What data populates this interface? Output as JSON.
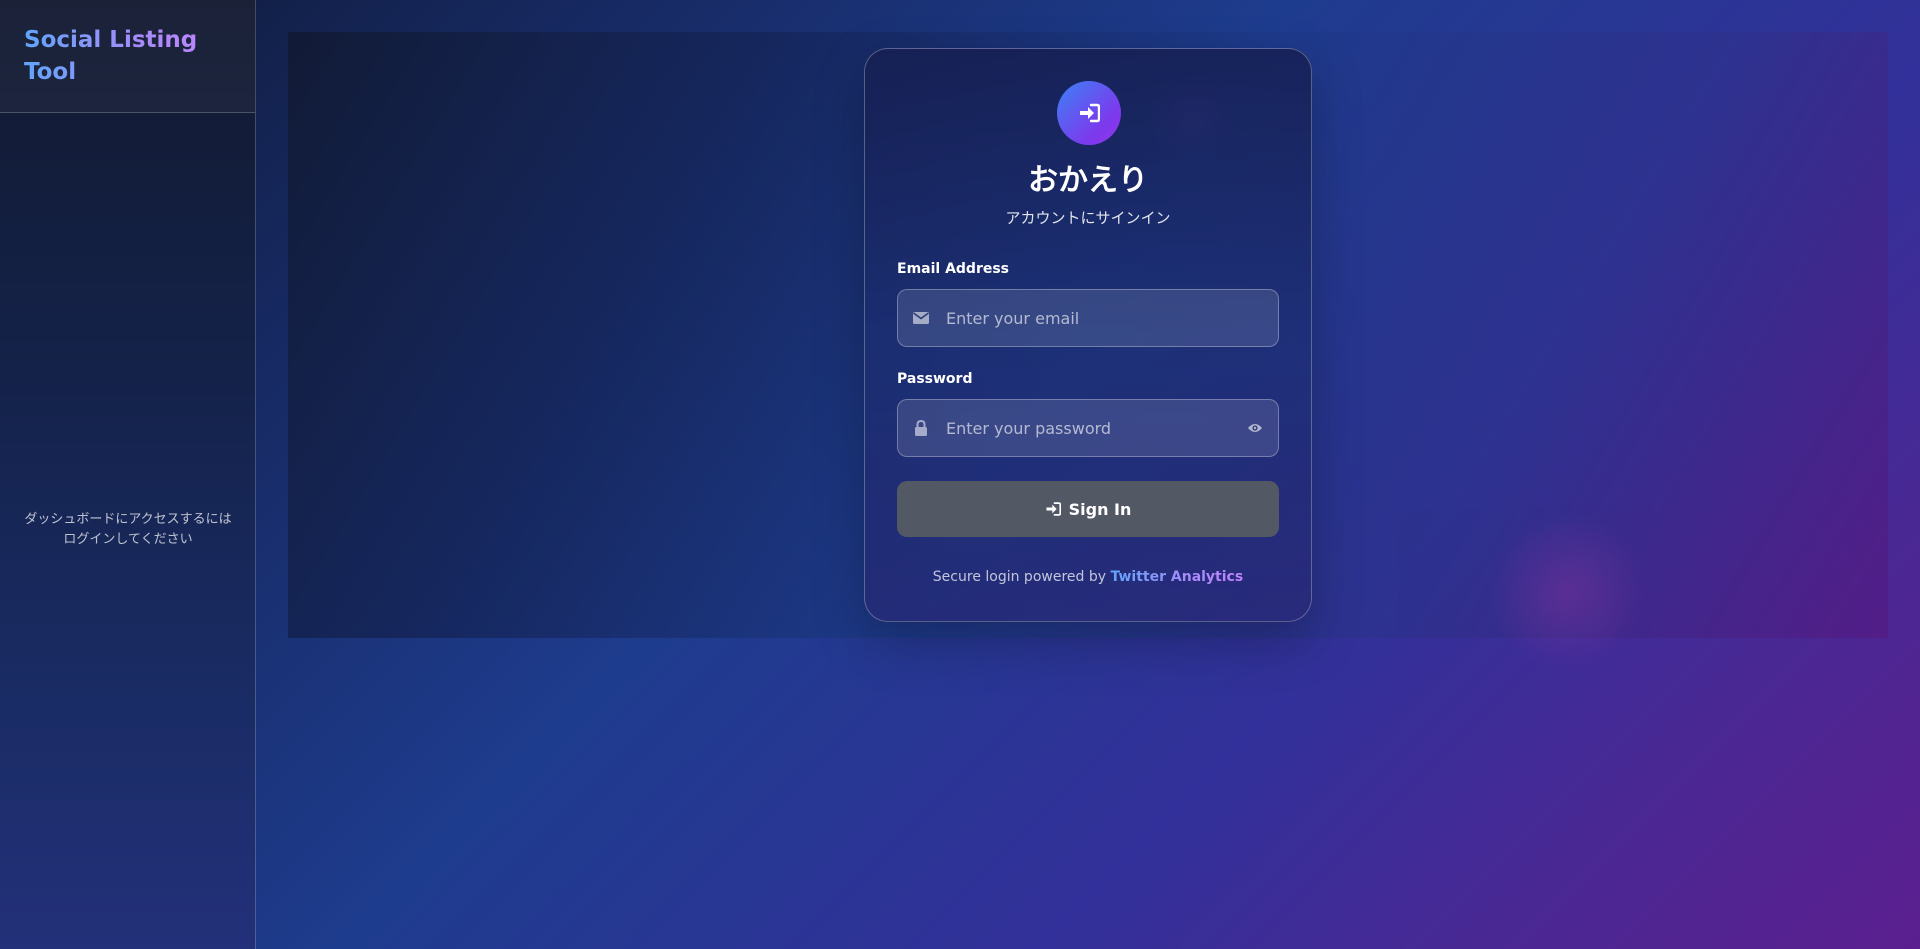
{
  "sidebar": {
    "brand": "Social Listing Tool",
    "message": "ダッシュボードにアクセスするにはログインしてください"
  },
  "login": {
    "title": "おかえり",
    "subtitle": "アカウントにサインイン",
    "email_label": "Email Address",
    "email_placeholder": "Enter your email",
    "email_icon": "envelope-icon",
    "password_label": "Password",
    "password_placeholder": "Enter your password",
    "password_icon": "lock-icon",
    "password_toggle_icon": "eye-icon",
    "signin_label": "Sign In",
    "signin_icon": "sign-in-icon",
    "footer_prefix": "Secure login powered by",
    "footer_link": "Twitter Analytics"
  },
  "colors": {
    "accent_blue": "#60a5fa",
    "accent_purple": "#a78bfa",
    "button_bg": "#525864"
  }
}
